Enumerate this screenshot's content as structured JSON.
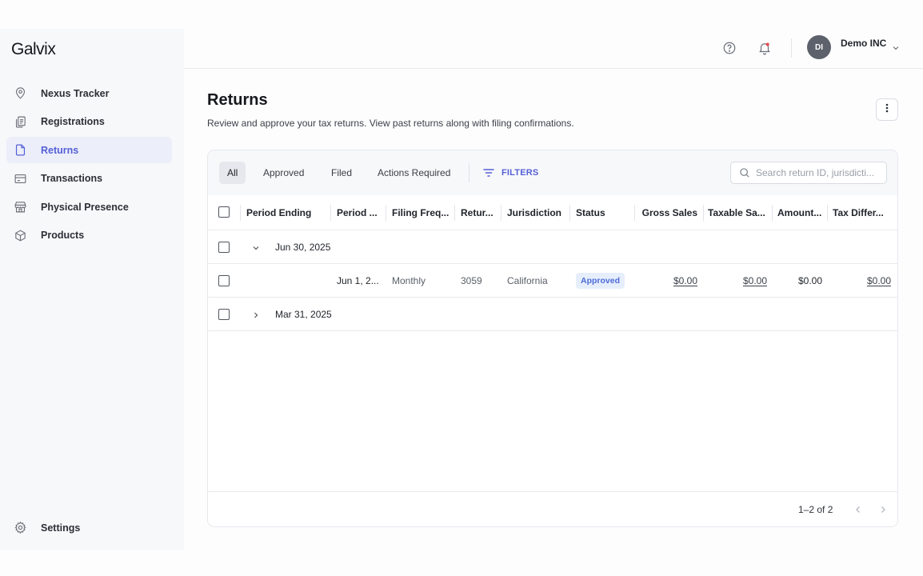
{
  "app": {
    "logo": "Galvix"
  },
  "sidebar": {
    "items": [
      {
        "label": "Nexus Tracker",
        "icon": "location-pin-icon",
        "active": false
      },
      {
        "label": "Registrations",
        "icon": "documents-icon",
        "active": false
      },
      {
        "label": "Returns",
        "icon": "file-icon",
        "active": true
      },
      {
        "label": "Transactions",
        "icon": "card-icon",
        "active": false
      },
      {
        "label": "Physical Presence",
        "icon": "building-icon",
        "active": false
      },
      {
        "label": "Products",
        "icon": "box-icon",
        "active": false
      }
    ],
    "settings_label": "Settings"
  },
  "header": {
    "avatar_initials": "DI",
    "company_name": "Demo INC",
    "notification_dot_color": "#e5484d"
  },
  "page": {
    "title": "Returns",
    "subtitle": "Review and approve your tax returns. View past returns along with filing confirmations."
  },
  "toolbar": {
    "tabs": [
      "All",
      "Approved",
      "Filed",
      "Actions Required"
    ],
    "active_tab": "All",
    "filters_label": "FILTERS",
    "search_placeholder": "Search return ID, jurisdicti..."
  },
  "table": {
    "columns": [
      "Period Ending",
      "Period ...",
      "Filing Freq...",
      "Retur...",
      "Jurisdiction",
      "Status",
      "Gross Sales",
      "Taxable Sa...",
      "Amount...",
      "Tax Differ..."
    ],
    "groups": [
      {
        "period_ending": "Jun 30, 2025",
        "expanded": true,
        "rows": [
          {
            "period_start": "Jun 1, 2...",
            "filing_frequency": "Monthly",
            "return_id": "3059",
            "jurisdiction": "California",
            "status": "Approved",
            "gross_sales": "$0.00",
            "taxable_sales": "$0.00",
            "amount": "$0.00",
            "tax_difference": "$0.00"
          }
        ]
      },
      {
        "period_ending": "Mar 31, 2025",
        "expanded": false,
        "rows": []
      }
    ]
  },
  "pagination": {
    "range": "1–2 of 2"
  },
  "colors": {
    "accent": "#5560d6",
    "status_badge_bg": "#e6eefc"
  }
}
